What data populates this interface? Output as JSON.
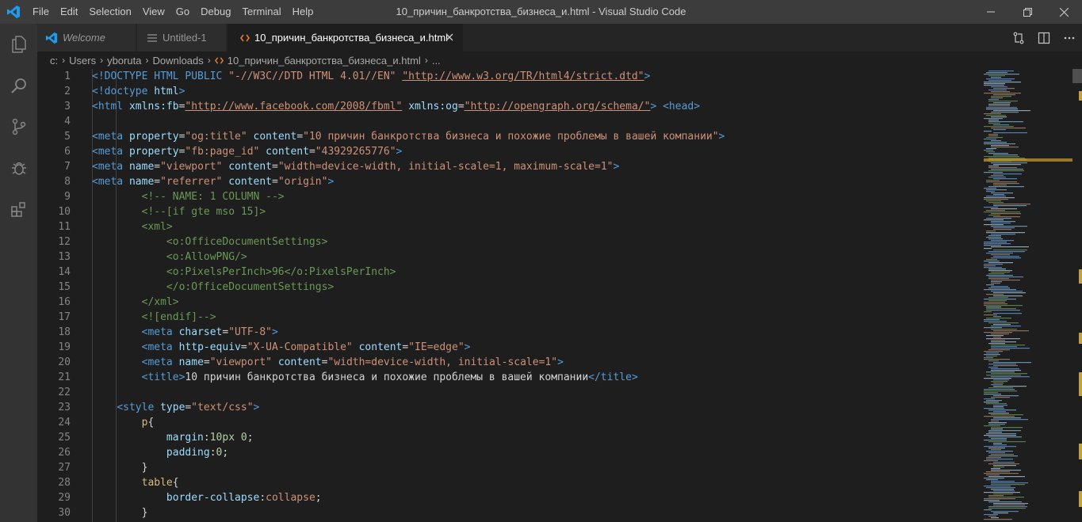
{
  "titlebar": {
    "menu": [
      "File",
      "Edit",
      "Selection",
      "View",
      "Go",
      "Debug",
      "Terminal",
      "Help"
    ],
    "window_title": "10_причин_банкротства_бизнеса_и.html - Visual Studio Code"
  },
  "tabs": [
    {
      "label": "Welcome",
      "icon": "vscode-logo-icon"
    },
    {
      "label": "Untitled-1",
      "icon": "lines-icon"
    },
    {
      "label": "10_причин_банкротства_бизнеса_и.html",
      "icon": "html-brackets-icon",
      "active": true
    }
  ],
  "breadcrumb": [
    "c:",
    "Users",
    "yboruta",
    "Downloads",
    "10_причин_банкротства_бизнеса_и.html",
    "..."
  ],
  "editor": {
    "lines": [
      {
        "n": "1",
        "t": [
          [
            "<!DOCTYPE HTML PUBLIC ",
            "c-tag"
          ],
          [
            "\"-//W3C//DTD HTML 4.01//EN\"",
            "c-str"
          ],
          [
            " ",
            "c-txt"
          ],
          [
            "\"http://www.w3.org/TR/html4/strict.dtd\"",
            "c-str u"
          ],
          [
            ">",
            "c-tag"
          ]
        ]
      },
      {
        "n": "2",
        "t": [
          [
            "<!doctype ",
            "c-tag"
          ],
          [
            "html",
            "c-attr"
          ],
          [
            ">",
            "c-tag"
          ]
        ]
      },
      {
        "n": "3",
        "t": [
          [
            "<html ",
            "c-tag"
          ],
          [
            "xmlns:fb",
            "c-attr"
          ],
          [
            "=",
            "c-txt"
          ],
          [
            "\"http://www.facebook.com/2008/fbml\"",
            "c-str u"
          ],
          [
            " ",
            "c-txt"
          ],
          [
            "xmlns:og",
            "c-attr"
          ],
          [
            "=",
            "c-txt"
          ],
          [
            "\"http://opengraph.org/schema/\"",
            "c-str u"
          ],
          [
            "> ",
            "c-tag"
          ],
          [
            "<head>",
            "c-tag"
          ]
        ]
      },
      {
        "n": "4",
        "t": []
      },
      {
        "n": "5",
        "t": [
          [
            "<meta ",
            "c-tag"
          ],
          [
            "property",
            "c-attr"
          ],
          [
            "=",
            "c-txt"
          ],
          [
            "\"og:title\"",
            "c-str"
          ],
          [
            " ",
            "c-txt"
          ],
          [
            "content",
            "c-attr"
          ],
          [
            "=",
            "c-txt"
          ],
          [
            "\"10 причин банкротства бизнеса и похожие проблемы в вашей компании\"",
            "c-str"
          ],
          [
            ">",
            "c-tag"
          ]
        ]
      },
      {
        "n": "6",
        "t": [
          [
            "<meta ",
            "c-tag"
          ],
          [
            "property",
            "c-attr"
          ],
          [
            "=",
            "c-txt"
          ],
          [
            "\"fb:page_id\"",
            "c-str"
          ],
          [
            " ",
            "c-txt"
          ],
          [
            "content",
            "c-attr"
          ],
          [
            "=",
            "c-txt"
          ],
          [
            "\"43929265776\"",
            "c-str"
          ],
          [
            ">",
            "c-tag"
          ]
        ]
      },
      {
        "n": "7",
        "t": [
          [
            "<meta ",
            "c-tag"
          ],
          [
            "name",
            "c-attr"
          ],
          [
            "=",
            "c-txt"
          ],
          [
            "\"viewport\"",
            "c-str"
          ],
          [
            " ",
            "c-txt"
          ],
          [
            "content",
            "c-attr"
          ],
          [
            "=",
            "c-txt"
          ],
          [
            "\"width=device-width, initial-scale=1, maximum-scale=1\"",
            "c-str"
          ],
          [
            ">",
            "c-tag"
          ]
        ]
      },
      {
        "n": "8",
        "t": [
          [
            "<meta ",
            "c-tag"
          ],
          [
            "name",
            "c-attr"
          ],
          [
            "=",
            "c-txt"
          ],
          [
            "\"referrer\"",
            "c-str"
          ],
          [
            " ",
            "c-txt"
          ],
          [
            "content",
            "c-attr"
          ],
          [
            "=",
            "c-txt"
          ],
          [
            "\"origin\"",
            "c-str"
          ],
          [
            ">",
            "c-tag"
          ]
        ]
      },
      {
        "n": "9",
        "t": [
          [
            "        ",
            "c-txt"
          ],
          [
            "<!-- NAME: 1 COLUMN -->",
            "c-com"
          ]
        ]
      },
      {
        "n": "10",
        "t": [
          [
            "        ",
            "c-txt"
          ],
          [
            "<!--[if gte mso 15]>",
            "c-com"
          ]
        ]
      },
      {
        "n": "11",
        "t": [
          [
            "        ",
            "c-txt"
          ],
          [
            "<xml>",
            "c-com"
          ]
        ]
      },
      {
        "n": "12",
        "t": [
          [
            "            ",
            "c-txt"
          ],
          [
            "<o:OfficeDocumentSettings>",
            "c-com"
          ]
        ]
      },
      {
        "n": "13",
        "t": [
          [
            "            ",
            "c-txt"
          ],
          [
            "<o:AllowPNG/>",
            "c-com"
          ]
        ]
      },
      {
        "n": "14",
        "t": [
          [
            "            ",
            "c-txt"
          ],
          [
            "<o:PixelsPerInch>96</o:PixelsPerInch>",
            "c-com"
          ]
        ]
      },
      {
        "n": "15",
        "t": [
          [
            "            ",
            "c-txt"
          ],
          [
            "</o:OfficeDocumentSettings>",
            "c-com"
          ]
        ]
      },
      {
        "n": "16",
        "t": [
          [
            "        ",
            "c-txt"
          ],
          [
            "</xml>",
            "c-com"
          ]
        ]
      },
      {
        "n": "17",
        "t": [
          [
            "        ",
            "c-txt"
          ],
          [
            "<![endif]-->",
            "c-com"
          ]
        ]
      },
      {
        "n": "18",
        "t": [
          [
            "        ",
            "c-txt"
          ],
          [
            "<meta ",
            "c-tag"
          ],
          [
            "charset",
            "c-attr"
          ],
          [
            "=",
            "c-txt"
          ],
          [
            "\"UTF-8\"",
            "c-str"
          ],
          [
            ">",
            "c-tag"
          ]
        ]
      },
      {
        "n": "19",
        "t": [
          [
            "        ",
            "c-txt"
          ],
          [
            "<meta ",
            "c-tag"
          ],
          [
            "http-equiv",
            "c-attr"
          ],
          [
            "=",
            "c-txt"
          ],
          [
            "\"X-UA-Compatible\"",
            "c-str"
          ],
          [
            " ",
            "c-txt"
          ],
          [
            "content",
            "c-attr"
          ],
          [
            "=",
            "c-txt"
          ],
          [
            "\"IE=edge\"",
            "c-str"
          ],
          [
            ">",
            "c-tag"
          ]
        ]
      },
      {
        "n": "20",
        "t": [
          [
            "        ",
            "c-txt"
          ],
          [
            "<meta ",
            "c-tag"
          ],
          [
            "name",
            "c-attr"
          ],
          [
            "=",
            "c-txt"
          ],
          [
            "\"viewport\"",
            "c-str"
          ],
          [
            " ",
            "c-txt"
          ],
          [
            "content",
            "c-attr"
          ],
          [
            "=",
            "c-txt"
          ],
          [
            "\"width=device-width, initial-scale=1\"",
            "c-str"
          ],
          [
            ">",
            "c-tag"
          ]
        ]
      },
      {
        "n": "21",
        "t": [
          [
            "        ",
            "c-txt"
          ],
          [
            "<title>",
            "c-tag"
          ],
          [
            "10 причин банкротства бизнеса и похожие проблемы в вашей компании",
            "c-txt"
          ],
          [
            "</title>",
            "c-tag"
          ]
        ]
      },
      {
        "n": "22",
        "t": []
      },
      {
        "n": "23",
        "t": [
          [
            "    ",
            "c-txt"
          ],
          [
            "<style ",
            "c-tag"
          ],
          [
            "type",
            "c-attr"
          ],
          [
            "=",
            "c-txt"
          ],
          [
            "\"text/css\"",
            "c-str"
          ],
          [
            ">",
            "c-tag"
          ]
        ]
      },
      {
        "n": "24",
        "t": [
          [
            "        ",
            "c-txt"
          ],
          [
            "p",
            "c-sel"
          ],
          [
            "{",
            "c-txt"
          ]
        ]
      },
      {
        "n": "25",
        "t": [
          [
            "            ",
            "c-txt"
          ],
          [
            "margin",
            "c-prop"
          ],
          [
            ":",
            "c-txt"
          ],
          [
            "10px 0",
            "c-num"
          ],
          [
            ";",
            "c-txt"
          ]
        ]
      },
      {
        "n": "26",
        "t": [
          [
            "            ",
            "c-txt"
          ],
          [
            "padding",
            "c-prop"
          ],
          [
            ":",
            "c-txt"
          ],
          [
            "0",
            "c-num"
          ],
          [
            ";",
            "c-txt"
          ]
        ]
      },
      {
        "n": "27",
        "t": [
          [
            "        ",
            "c-txt"
          ],
          [
            "}",
            "c-txt"
          ]
        ]
      },
      {
        "n": "28",
        "t": [
          [
            "        ",
            "c-txt"
          ],
          [
            "table",
            "c-sel"
          ],
          [
            "{",
            "c-txt"
          ]
        ]
      },
      {
        "n": "29",
        "t": [
          [
            "            ",
            "c-txt"
          ],
          [
            "border-collapse",
            "c-prop"
          ],
          [
            ":",
            "c-txt"
          ],
          [
            "collapse",
            "c-str"
          ],
          [
            ";",
            "c-txt"
          ]
        ]
      },
      {
        "n": "30",
        "t": [
          [
            "        ",
            "c-txt"
          ],
          [
            "}",
            "c-txt"
          ]
        ]
      }
    ]
  },
  "colors": {
    "accent": "#007acc",
    "editor_bg": "#1e1e1e",
    "titlebar_bg": "#3c3c3c",
    "activitybar_bg": "#333333"
  }
}
